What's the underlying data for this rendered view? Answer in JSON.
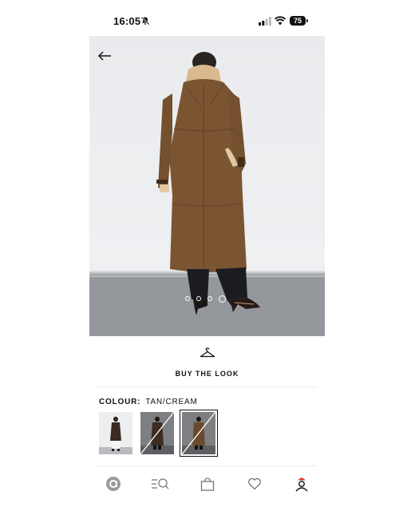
{
  "status_bar": {
    "time": "16:05",
    "battery": "75"
  },
  "gallery": {
    "page_count": 4,
    "active_index": 3
  },
  "buy_the_look": {
    "label": "BUY THE LOOK"
  },
  "colour": {
    "label": "COLOUR:",
    "value": "TAN/CREAM",
    "swatches": [
      {
        "name": "light",
        "available": true,
        "selected": false
      },
      {
        "name": "dark-brown",
        "available": false,
        "selected": false
      },
      {
        "name": "tan-cream",
        "available": false,
        "selected": true
      }
    ]
  },
  "nav": {
    "items": [
      {
        "name": "home",
        "icon": "home-logo-icon"
      },
      {
        "name": "search",
        "icon": "menu-search-icon"
      },
      {
        "name": "bag",
        "icon": "bag-icon"
      },
      {
        "name": "wishlist",
        "icon": "heart-icon"
      },
      {
        "name": "account",
        "icon": "account-icon"
      }
    ]
  },
  "colors": {
    "accent": "#111111",
    "notification": "#e0302c",
    "coat": "#7b5532"
  }
}
